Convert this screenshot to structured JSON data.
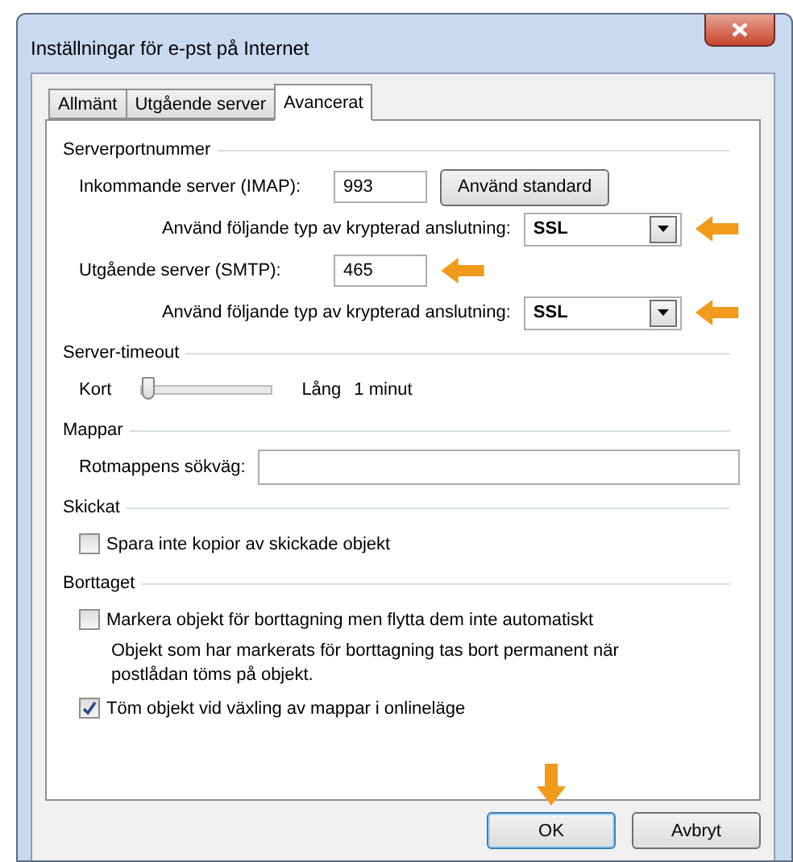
{
  "window": {
    "title": "Inställningar för e-pst på Internet"
  },
  "tabs": [
    {
      "label": "Allmänt",
      "selected": false
    },
    {
      "label": "Utgående server",
      "selected": false
    },
    {
      "label": "Avancerat",
      "selected": true
    }
  ],
  "sections": [
    {
      "title": "Serverportnummer",
      "rows": [
        {
          "kind": "port",
          "label": "Inkommande server (IMAP):",
          "value": "993",
          "button": "Använd standard",
          "arrow": false
        },
        {
          "kind": "select",
          "label": "Använd följande typ av krypterad anslutning:",
          "value": "SSL",
          "arrow": true
        },
        {
          "kind": "port",
          "label": "Utgående server (SMTP):",
          "value": "465",
          "arrow": true
        },
        {
          "kind": "select",
          "label": "Använd följande typ av krypterad anslutning:",
          "value": "SSL",
          "arrow": true
        }
      ]
    },
    {
      "title": "Server-timeout",
      "rows": [
        {
          "kind": "slider",
          "min_label": "Kort",
          "max_label": "Lång",
          "reading": "1 minut",
          "level": 0
        }
      ]
    },
    {
      "title": "Mappar",
      "rows": [
        {
          "kind": "text",
          "label": "Rotmappens sökväg:"
        }
      ]
    },
    {
      "title": "Skickat",
      "rows": [
        {
          "kind": "check",
          "label": "Spara inte kopior av skickade objekt",
          "checked": false
        }
      ]
    },
    {
      "title": "Borttaget",
      "rows": [
        {
          "kind": "check",
          "label": "Markera objekt för borttagning men flytta dem inte automatiskt",
          "checked": false
        },
        {
          "kind": "note",
          "label": "Objekt som har markerats för borttagning tas bort permanent när postlådan töms på objekt."
        },
        {
          "kind": "check",
          "label": "Töm objekt vid växling av mappar i onlineläge",
          "checked": true
        }
      ]
    }
  ],
  "buttons": [
    {
      "label": "OK",
      "default": true,
      "arrow": true
    },
    {
      "label": "Avbryt",
      "default": false,
      "arrow": false
    }
  ]
}
